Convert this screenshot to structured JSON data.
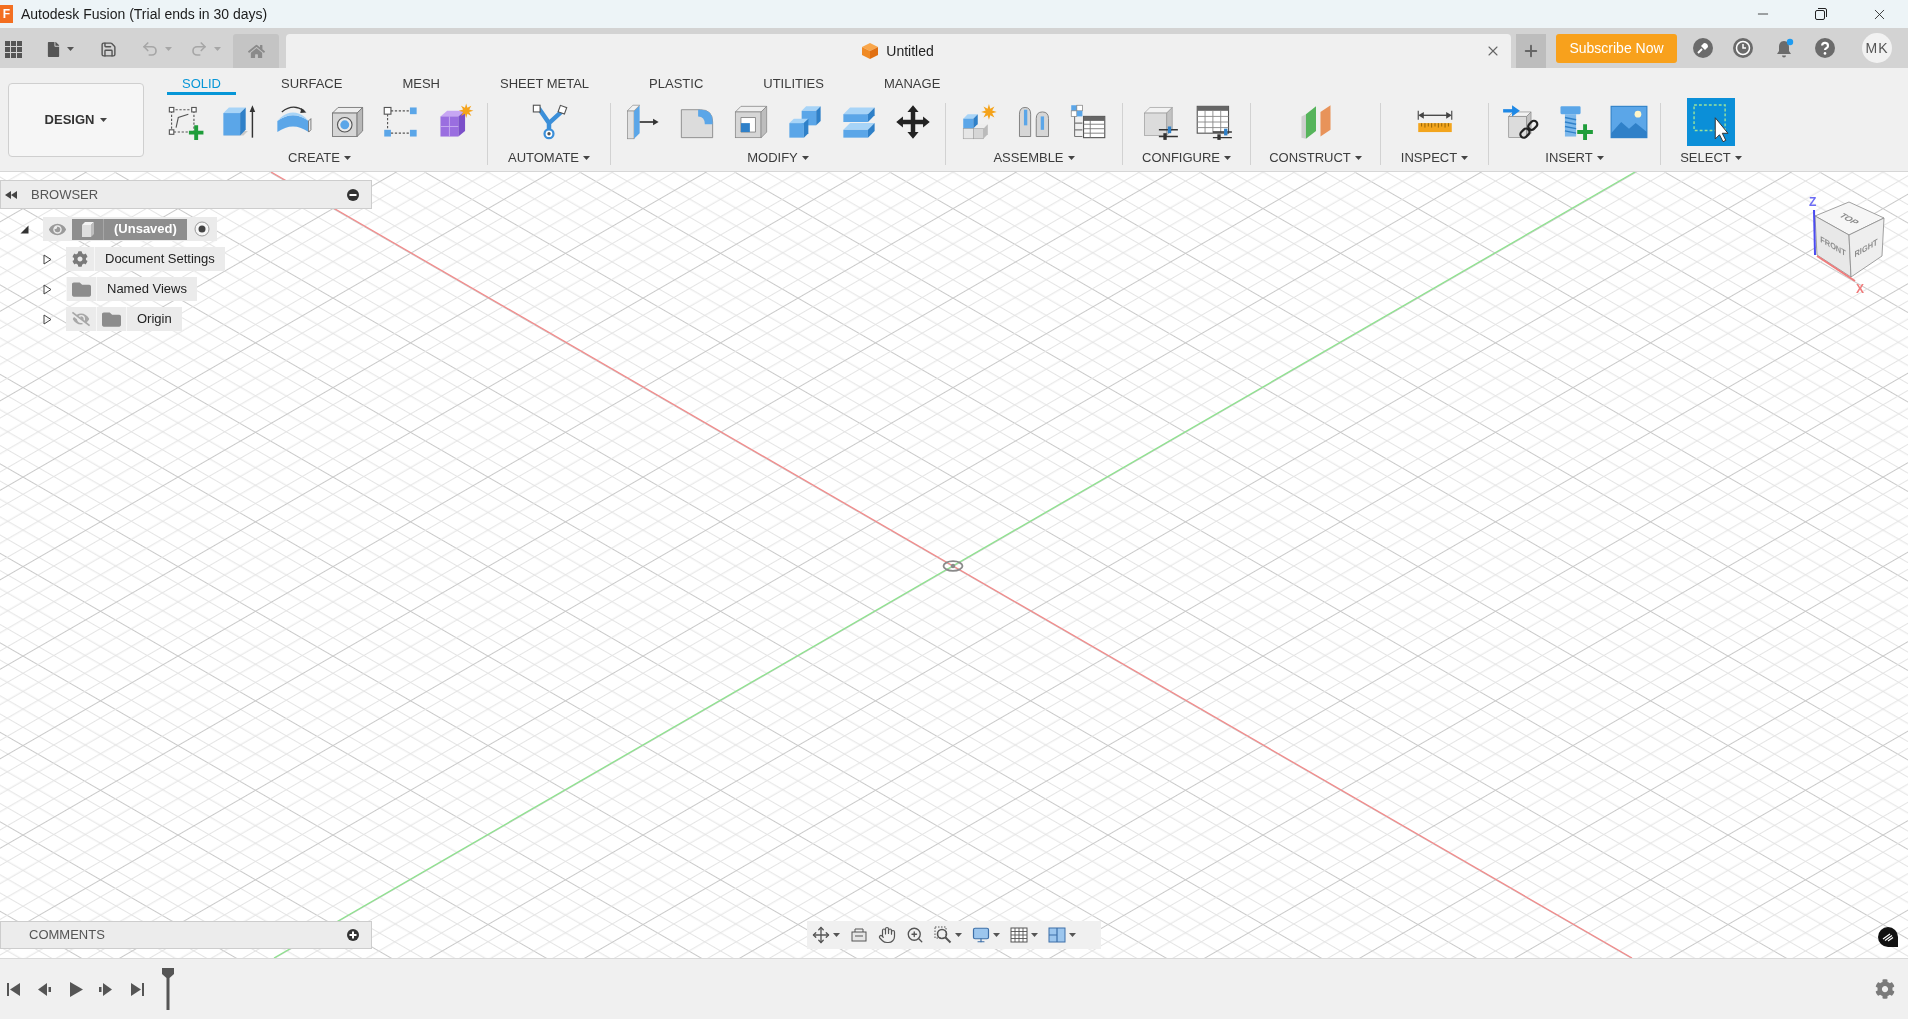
{
  "window": {
    "logo_letter": "F",
    "title": "Autodesk Fusion (Trial ends in 30 days)"
  },
  "quick_access": {
    "undo": {
      "disabled": true
    },
    "redo": {
      "disabled": true
    }
  },
  "document_tab": {
    "title": "Untitled"
  },
  "header": {
    "subscribe_button": "Subscribe Now",
    "unread_notifications": true,
    "avatar_initials": "MK"
  },
  "workspace_menu": {
    "label": "DESIGN"
  },
  "tabs": [
    {
      "label": "SOLID",
      "selected": true
    },
    {
      "label": "SURFACE",
      "selected": false
    },
    {
      "label": "MESH",
      "selected": false
    },
    {
      "label": "SHEET METAL",
      "selected": false
    },
    {
      "label": "PLASTIC",
      "selected": false
    },
    {
      "label": "UTILITIES",
      "selected": false
    },
    {
      "label": "MANAGE",
      "selected": false
    }
  ],
  "tool_groups": [
    {
      "label": "CREATE"
    },
    {
      "label": "AUTOMATE"
    },
    {
      "label": "MODIFY"
    },
    {
      "label": "ASSEMBLE"
    },
    {
      "label": "CONFIGURE"
    },
    {
      "label": "CONSTRUCT"
    },
    {
      "label": "INSPECT"
    },
    {
      "label": "INSERT"
    },
    {
      "label": "SELECT"
    }
  ],
  "browser": {
    "title": "BROWSER",
    "tree": [
      {
        "label": "(Unsaved)",
        "kind": "component",
        "expanded": true,
        "visible": true,
        "active": true,
        "children": [
          {
            "label": "Document Settings",
            "kind": "settings",
            "expanded": false
          },
          {
            "label": "Named Views",
            "kind": "folder",
            "expanded": false
          },
          {
            "label": "Origin",
            "kind": "folder",
            "expanded": false,
            "visible": false
          }
        ]
      }
    ]
  },
  "view_cube": {
    "top_face": "TOP",
    "front_face": "FRONT",
    "right_face": "RIGHT",
    "z_axis": "Z",
    "x_axis": "X"
  },
  "comments": {
    "title": "COMMENTS"
  }
}
